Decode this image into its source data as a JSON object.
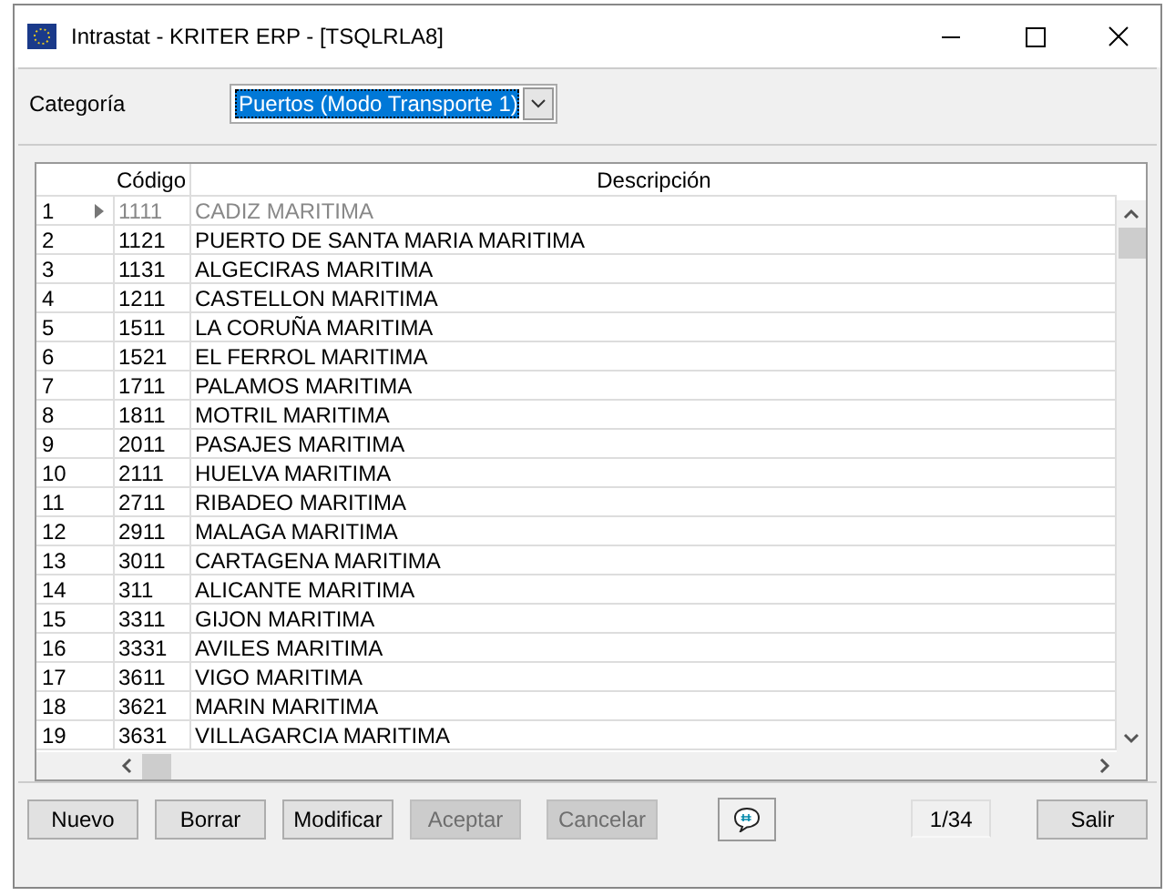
{
  "window": {
    "title": "Intrastat - KRITER ERP - [TSQLRLA8]"
  },
  "category": {
    "label": "Categoría",
    "value": "Puertos (Modo Transporte 1)"
  },
  "table": {
    "columns": [
      "Código",
      "Descripción"
    ],
    "rows": [
      {
        "number": "1",
        "code": "1111",
        "description": "CADIZ MARITIMA",
        "selected": true
      },
      {
        "number": "2",
        "code": "1121",
        "description": "PUERTO DE SANTA MARIA MARITIMA",
        "selected": false
      },
      {
        "number": "3",
        "code": "1131",
        "description": "ALGECIRAS MARITIMA",
        "selected": false
      },
      {
        "number": "4",
        "code": "1211",
        "description": "CASTELLON MARITIMA",
        "selected": false
      },
      {
        "number": "5",
        "code": "1511",
        "description": "LA CORUÑA MARITIMA",
        "selected": false
      },
      {
        "number": "6",
        "code": "1521",
        "description": "EL FERROL MARITIMA",
        "selected": false
      },
      {
        "number": "7",
        "code": "1711",
        "description": "PALAMOS MARITIMA",
        "selected": false
      },
      {
        "number": "8",
        "code": "1811",
        "description": "MOTRIL MARITIMA",
        "selected": false
      },
      {
        "number": "9",
        "code": "2011",
        "description": "PASAJES MARITIMA",
        "selected": false
      },
      {
        "number": "10",
        "code": "2111",
        "description": "HUELVA MARITIMA",
        "selected": false
      },
      {
        "number": "11",
        "code": "2711",
        "description": "RIBADEO MARITIMA",
        "selected": false
      },
      {
        "number": "12",
        "code": "2911",
        "description": "MALAGA MARITIMA",
        "selected": false
      },
      {
        "number": "13",
        "code": "3011",
        "description": "CARTAGENA MARITIMA",
        "selected": false
      },
      {
        "number": "14",
        "code": "311",
        "description": "ALICANTE MARITIMA",
        "selected": false
      },
      {
        "number": "15",
        "code": "3311",
        "description": "GIJON MARITIMA",
        "selected": false
      },
      {
        "number": "16",
        "code": "3331",
        "description": "AVILES MARITIMA",
        "selected": false
      },
      {
        "number": "17",
        "code": "3611",
        "description": "VIGO MARITIMA",
        "selected": false
      },
      {
        "number": "18",
        "code": "3621",
        "description": "MARIN MARITIMA",
        "selected": false
      },
      {
        "number": "19",
        "code": "3631",
        "description": "VILLAGARCIA MARITIMA",
        "selected": false
      }
    ]
  },
  "buttons": [
    {
      "label": "Nuevo",
      "disabled": false
    },
    {
      "label": "Borrar",
      "disabled": false
    },
    {
      "label": "Modificar",
      "disabled": false
    },
    {
      "label": "Aceptar",
      "disabled": true
    },
    {
      "label": "Cancelar",
      "disabled": true
    }
  ],
  "record_counter": "1/34",
  "exit_button": {
    "label": "Salir"
  }
}
